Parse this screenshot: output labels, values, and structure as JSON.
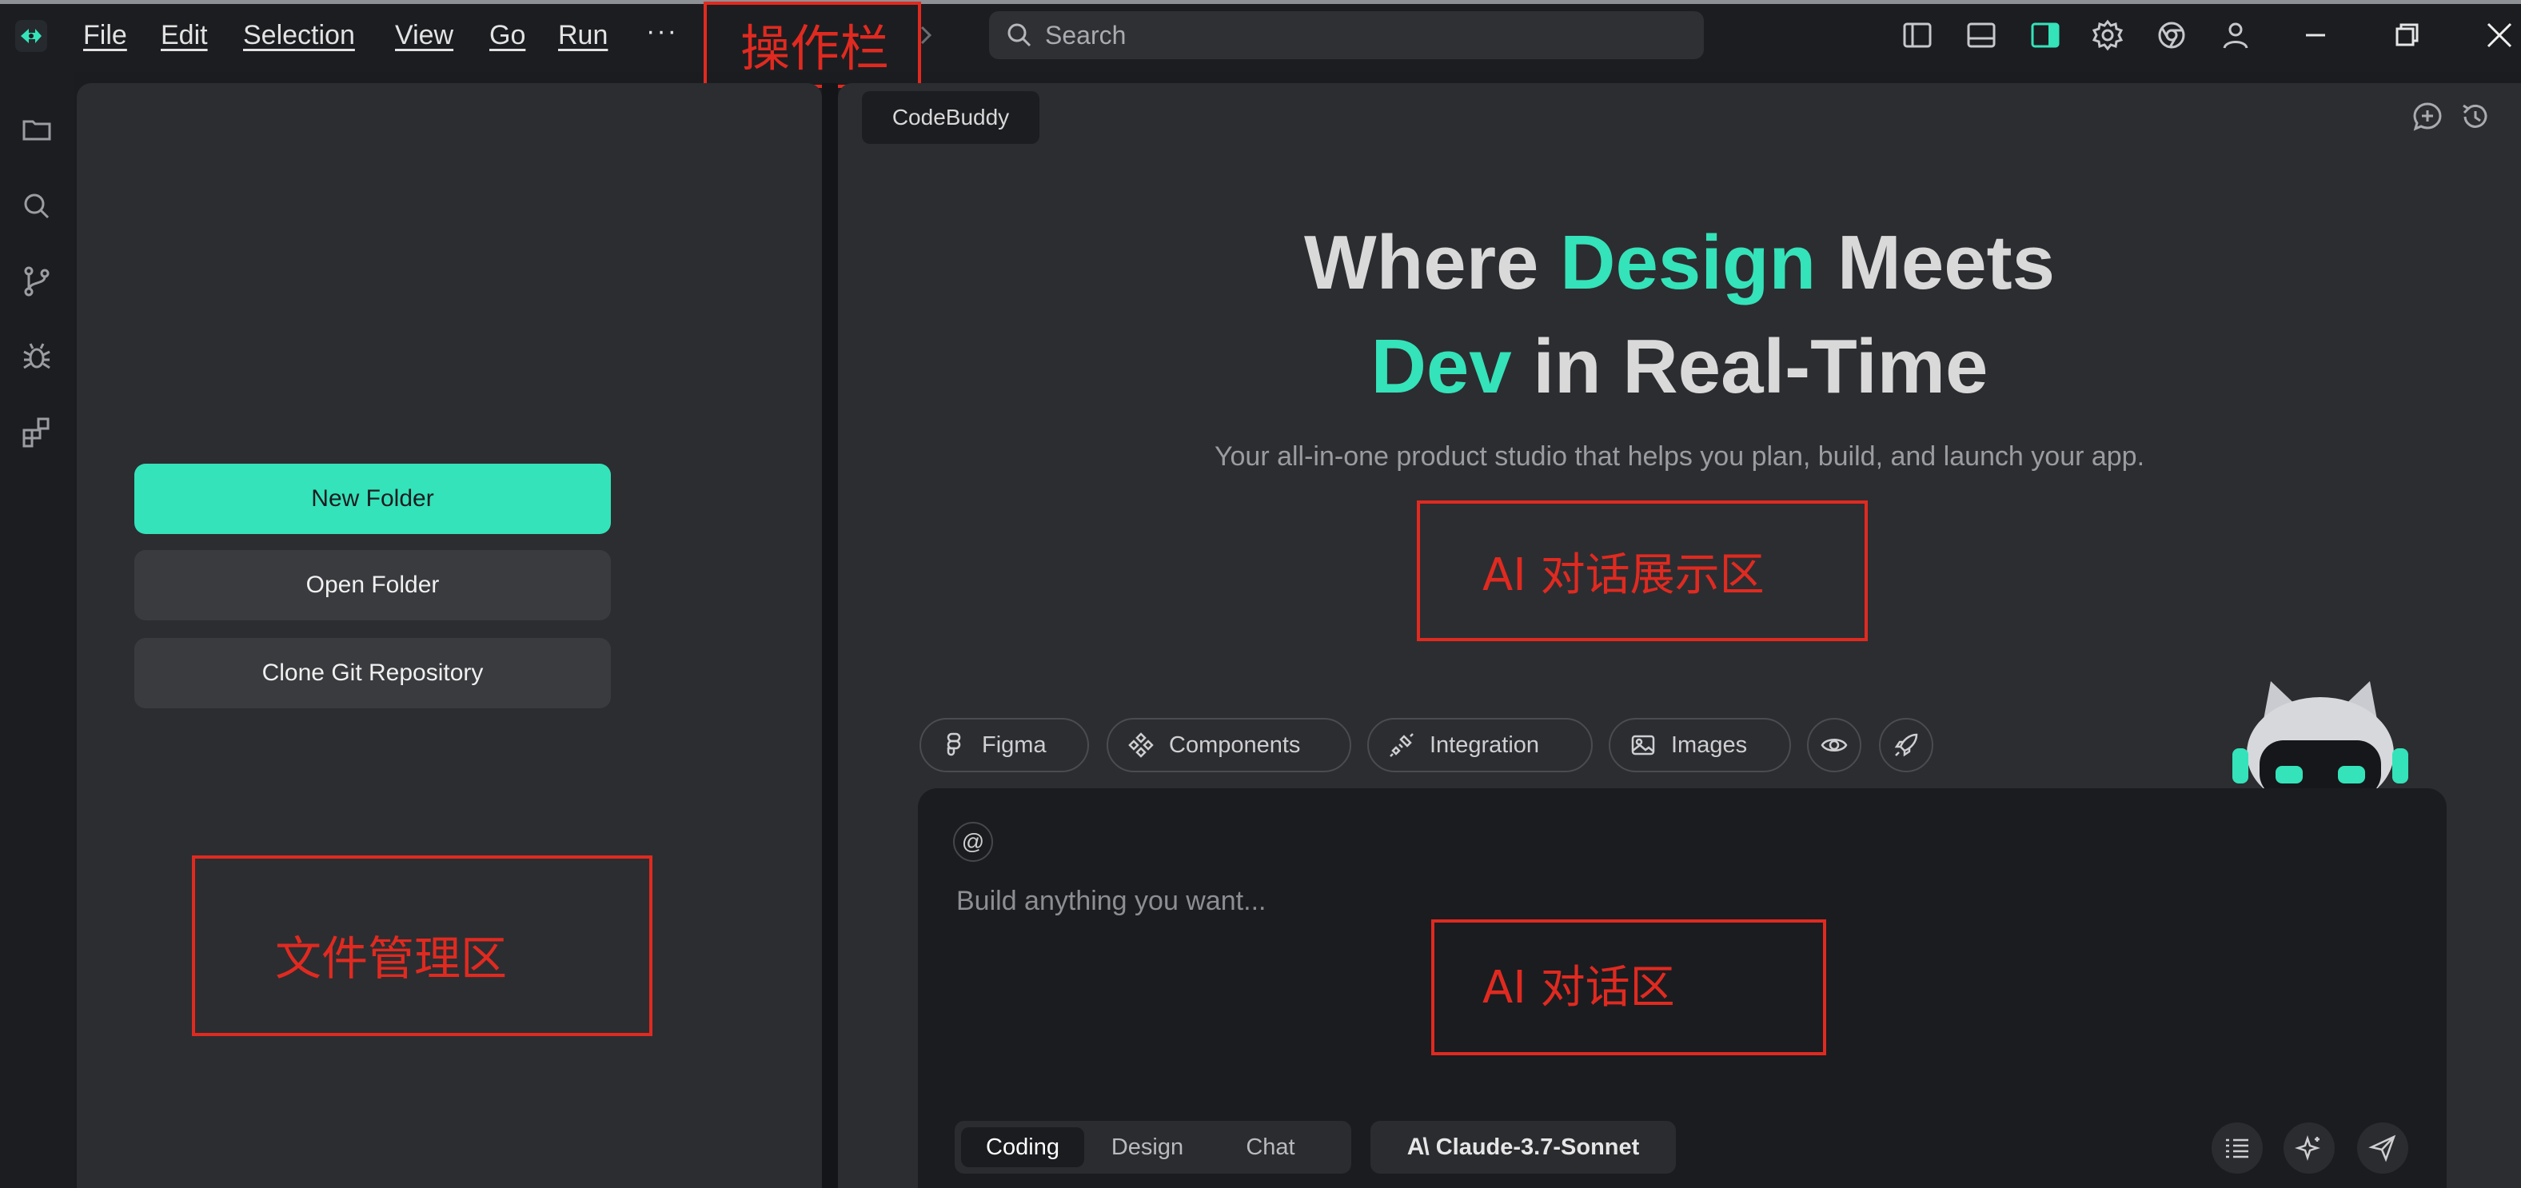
{
  "menu": {
    "items": [
      {
        "label": "File"
      },
      {
        "label": "Edit"
      },
      {
        "label": "Selection"
      },
      {
        "label": "View"
      },
      {
        "label": "Go"
      },
      {
        "label": "Run"
      }
    ],
    "more_label": "···"
  },
  "search": {
    "label": "Search"
  },
  "annotations": {
    "toolbar": "操作栏",
    "file_area": "文件管理区",
    "ai_display": "AI 对话展示区",
    "ai_chat": "AI 对话区"
  },
  "explorer": {
    "new_folder": "New Folder",
    "open_folder": "Open Folder",
    "clone_repo": "Clone Git Repository"
  },
  "chat": {
    "tab_label": "CodeBuddy",
    "hero": {
      "line1_pre": "Where ",
      "line1_accent": "Design",
      "line1_post": " Meets",
      "line2_accent": "Dev",
      "line2_post": " in Real-Time"
    },
    "subtitle": "Your all-in-one product studio that helps you plan, build, and launch your app.",
    "chips": [
      {
        "label": "Figma",
        "icon": "figma-icon"
      },
      {
        "label": "Components",
        "icon": "components-icon"
      },
      {
        "label": "Integration",
        "icon": "integration-icon"
      },
      {
        "label": "Images",
        "icon": "image-icon"
      }
    ],
    "mention_label": "@",
    "placeholder": "Build anything you want...",
    "modes": [
      "Coding",
      "Design",
      "Chat"
    ],
    "model_mark": "A\\",
    "model": "Claude-3.7-Sonnet"
  },
  "colors": {
    "accent": "#34e3b9",
    "annotation": "#e02a20",
    "background": "#1b1c20",
    "panel": "#2c2d31"
  }
}
